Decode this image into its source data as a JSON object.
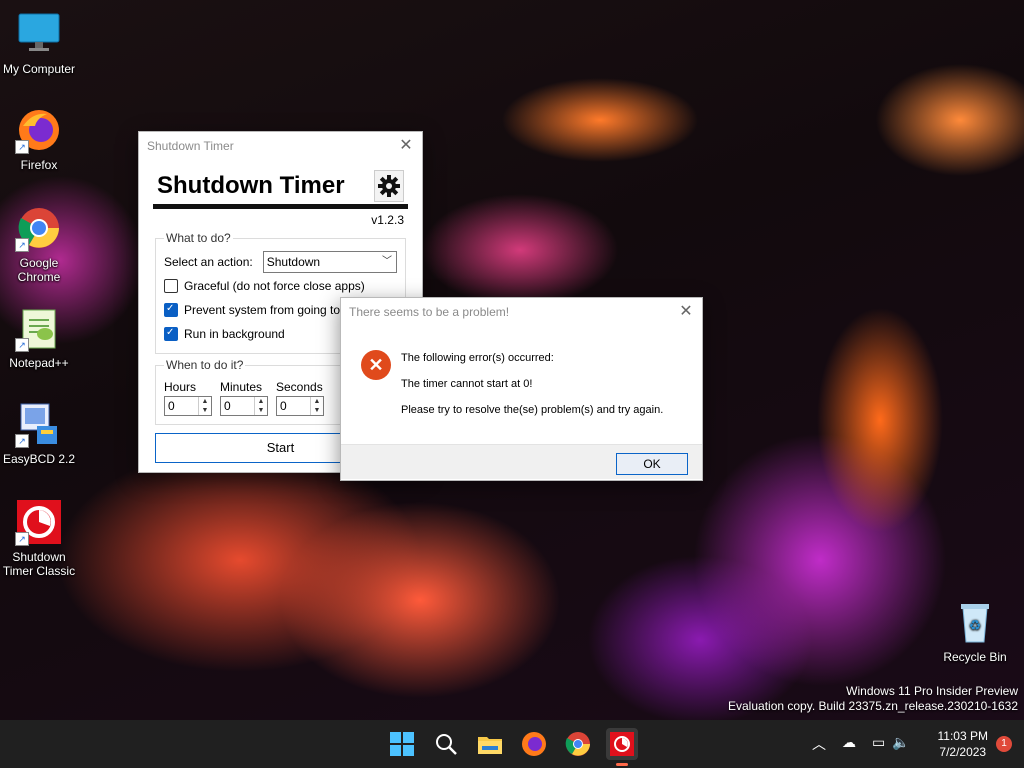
{
  "desktop": {
    "icons": [
      {
        "label": "My Computer"
      },
      {
        "label": "Firefox"
      },
      {
        "label": "Google Chrome"
      },
      {
        "label": "Notepad++"
      },
      {
        "label": "EasyBCD 2.2"
      },
      {
        "label": "Shutdown Timer Classic"
      },
      {
        "label": "Recycle Bin"
      }
    ],
    "watermark_line1": "Windows 11 Pro Insider Preview",
    "watermark_line2": "Evaluation copy. Build 23375.zn_release.230210-1632"
  },
  "main_window": {
    "title": "Shutdown Timer",
    "app_title": "Shutdown Timer",
    "version": "v1.2.3",
    "what_group": "What to do?",
    "action_label": "Select an action:",
    "action_value": "Shutdown",
    "graceful_label": "Graceful (do not force close apps)",
    "graceful_checked": false,
    "prevent_sleep_label": "Prevent system from going to slee",
    "prevent_sleep_checked": true,
    "background_label": "Run in background",
    "background_checked": true,
    "when_group": "When to do it?",
    "hours_label": "Hours",
    "hours_value": "0",
    "minutes_label": "Minutes",
    "minutes_value": "0",
    "seconds_label": "Seconds",
    "seconds_value": "0",
    "start_label": "Start"
  },
  "error_dialog": {
    "title": "There seems to be a problem!",
    "line1": "The following error(s) occurred:",
    "line2": "The timer cannot start at 0!",
    "line3": "Please try to resolve the(se) problem(s) and try again.",
    "ok_label": "OK"
  },
  "taskbar": {
    "apps": [
      "start-icon",
      "search-icon",
      "file-explorer-icon",
      "firefox-icon",
      "chrome-icon",
      "shutdown-timer-icon"
    ],
    "time": "11:03 PM",
    "date": "7/2/2023",
    "notification_count": "1"
  },
  "colors": {
    "accent": "#0a64c8",
    "error": "#e04a1c",
    "taskbar": "#202020"
  }
}
